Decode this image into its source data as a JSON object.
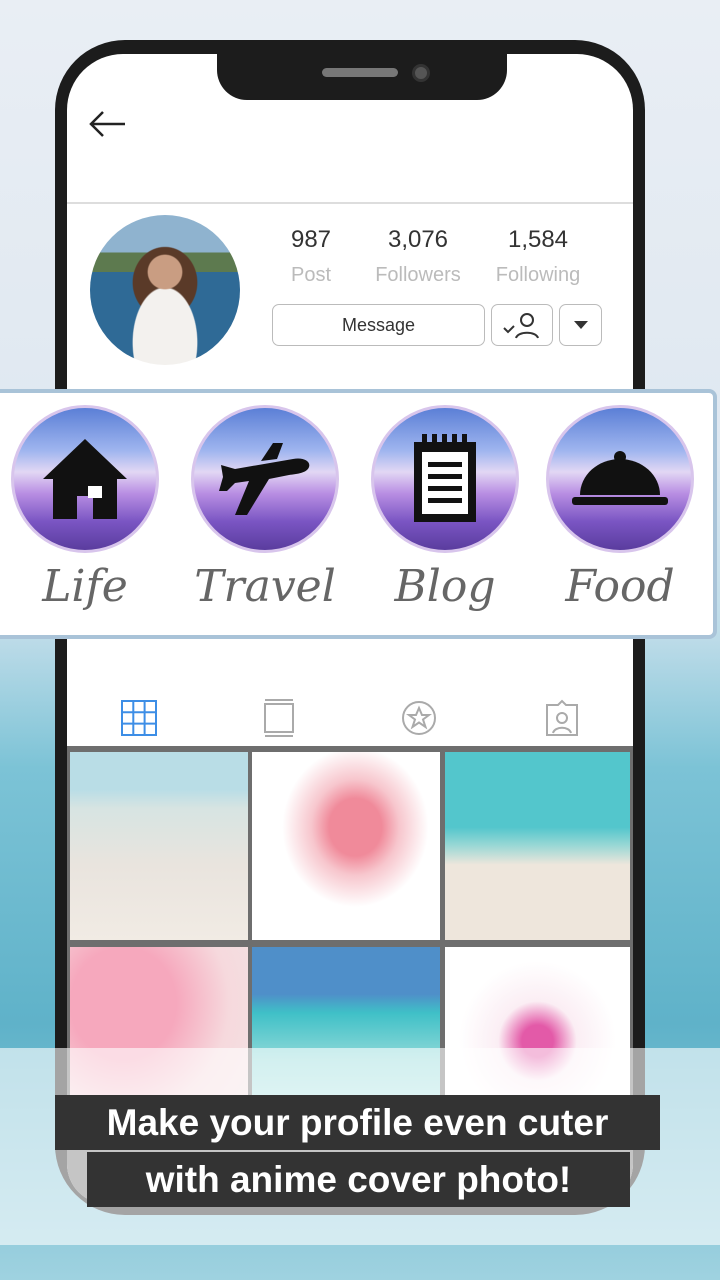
{
  "profile": {
    "posts": "987",
    "posts_label": "Post",
    "followers": "3,076",
    "followers_label": "Followers",
    "following": "1,584",
    "following_label": "Following"
  },
  "buttons": {
    "message": "Message"
  },
  "highlights": [
    {
      "label": "Life",
      "icon": "house-icon"
    },
    {
      "label": "Travel",
      "icon": "airplane-icon"
    },
    {
      "label": "Blog",
      "icon": "notepad-icon"
    },
    {
      "label": "Food",
      "icon": "cloche-icon"
    }
  ],
  "tabs": [
    {
      "icon": "grid-icon",
      "active": true
    },
    {
      "icon": "single-post-icon"
    },
    {
      "icon": "star-icon"
    },
    {
      "icon": "tagged-user-icon"
    }
  ],
  "colors": {
    "active_tab": "#3d8ee6",
    "caption_bg": "#333333"
  },
  "caption": {
    "line1": "Make your profile even cuter",
    "line2": "with anime cover photo!"
  }
}
